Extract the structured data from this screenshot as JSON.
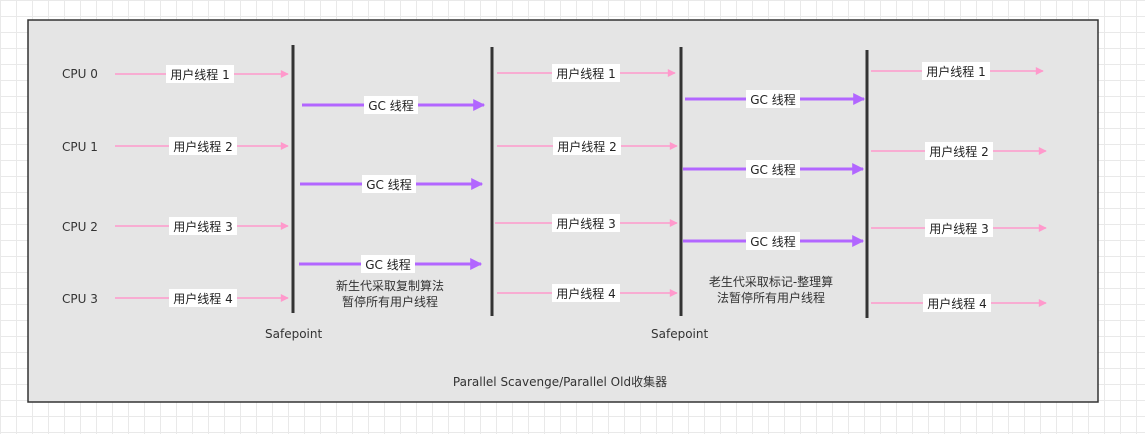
{
  "diagram": {
    "footer_title": "Parallel Scavenge/Parallel Old收集器",
    "cpus": [
      "CPU 0",
      "CPU 1",
      "CPU 2",
      "CPU 3"
    ],
    "barriers": [
      {
        "caption": "Safepoint"
      },
      {
        "caption": ""
      },
      {
        "caption": "Safepoint"
      },
      {
        "caption": ""
      }
    ],
    "user_thread_label_prefix": "用户线程",
    "gc_thread_label": "GC 线程",
    "phases": [
      {
        "type": "user",
        "threads": [
          "用户线程 1",
          "用户线程 2",
          "用户线程 3",
          "用户线程 4"
        ]
      },
      {
        "type": "gc",
        "threads": [
          "GC 线程",
          "GC 线程",
          "GC 线程"
        ],
        "note_lines": [
          "新生代采取复制算法",
          "暂停所有用户线程"
        ]
      },
      {
        "type": "user",
        "threads": [
          "用户线程 1",
          "用户线程 2",
          "用户线程 3",
          "用户线程 4"
        ]
      },
      {
        "type": "gc",
        "threads": [
          "GC 线程",
          "GC 线程",
          "GC 线程"
        ],
        "note_lines": [
          "老生代采取标记-整理算",
          "法暂停所有用户线程"
        ]
      },
      {
        "type": "user",
        "threads": [
          "用户线程 1",
          "用户线程 2",
          "用户线程 3",
          "用户线程 4"
        ]
      }
    ],
    "colors": {
      "user_arrow": "#ff99cc",
      "gc_arrow": "#b266ff",
      "barrier": "#333333",
      "panel": "#e5e5e5"
    }
  }
}
